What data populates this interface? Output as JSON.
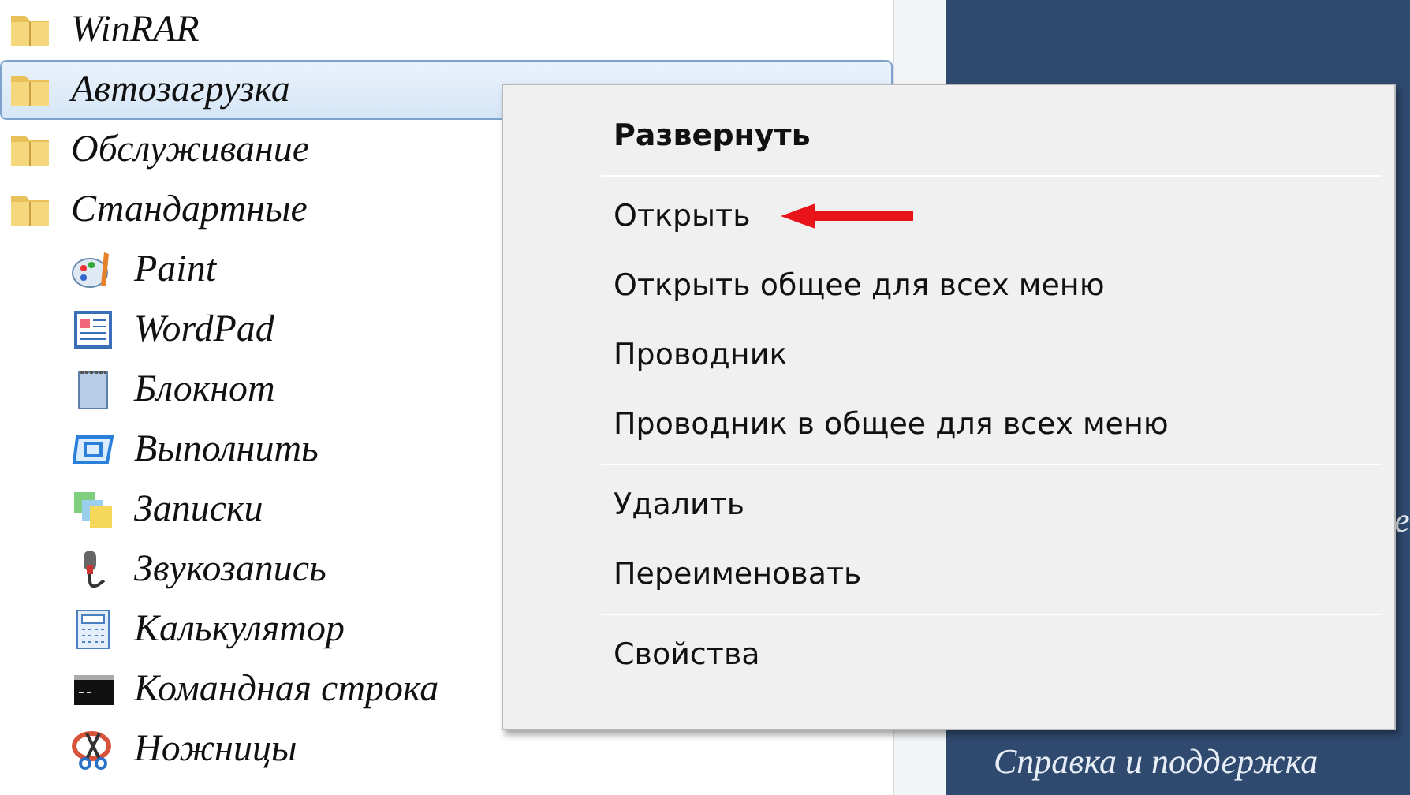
{
  "programs": [
    {
      "label": "WinRAR",
      "selected": false
    },
    {
      "label": "Автозагрузка",
      "selected": true
    },
    {
      "label": "Обслуживание",
      "selected": false
    },
    {
      "label": "Стандартные",
      "selected": false,
      "children": [
        {
          "label": "Paint",
          "selected": false
        },
        {
          "label": "WordPad",
          "selected": false
        },
        {
          "label": "Блокнот",
          "selected": false
        },
        {
          "label": "Выполнить",
          "selected": false
        },
        {
          "label": "Записки",
          "selected": false
        },
        {
          "label": "Звукозапись",
          "selected": false
        },
        {
          "label": "Калькулятор",
          "selected": false
        },
        {
          "label": "Командная строка",
          "selected": false
        },
        {
          "label": "Ножницы",
          "selected": false
        }
      ]
    }
  ],
  "right_panel": {
    "items": [
      "е"
    ],
    "footer": "Справка и поддержка"
  },
  "context_menu": [
    {
      "kind": "item",
      "label": "Развернуть",
      "default": true
    },
    {
      "kind": "separator"
    },
    {
      "kind": "item",
      "label": "Открыть",
      "default": false
    },
    {
      "kind": "item",
      "label": "Открыть общее для всех меню",
      "default": false
    },
    {
      "kind": "item",
      "label": "Проводник",
      "default": false
    },
    {
      "kind": "item",
      "label": "Проводник в общее для всех меню",
      "default": false
    },
    {
      "kind": "separator"
    },
    {
      "kind": "item",
      "label": "Удалить",
      "default": false
    },
    {
      "kind": "item",
      "label": "Переименовать",
      "default": false
    },
    {
      "kind": "separator"
    },
    {
      "kind": "item",
      "label": "Свойства",
      "default": false
    }
  ]
}
